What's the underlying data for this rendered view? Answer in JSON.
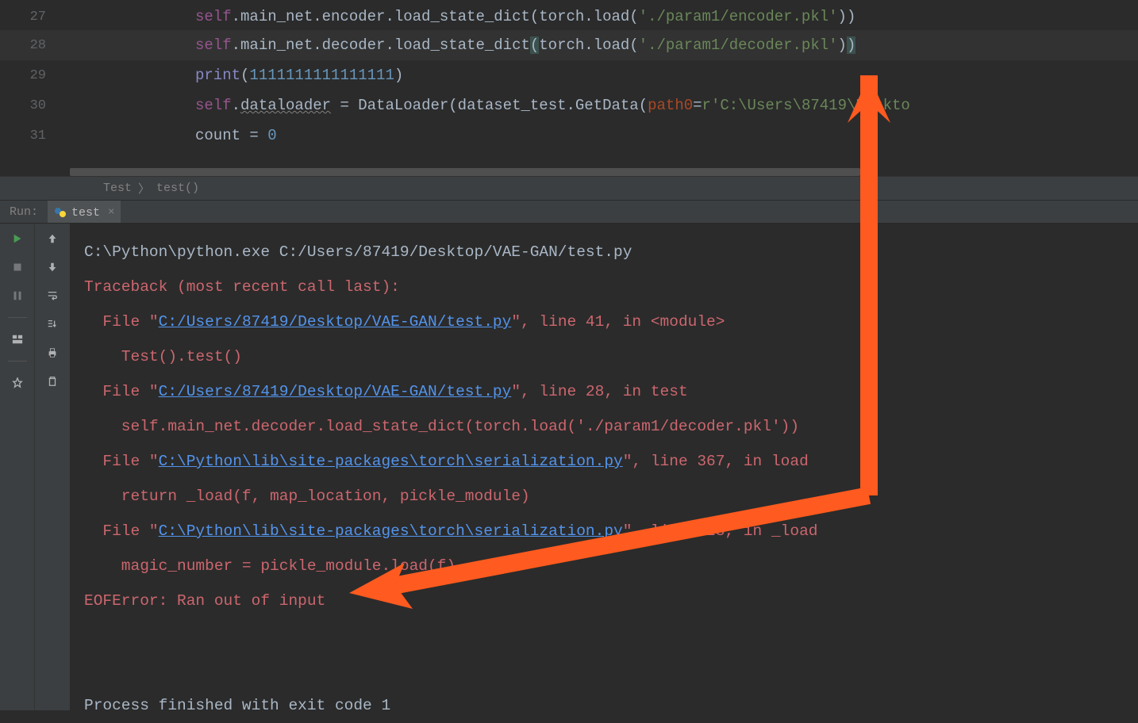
{
  "editor": {
    "lines": [
      {
        "num": "27"
      },
      {
        "num": "28"
      },
      {
        "num": "29"
      },
      {
        "num": "30"
      },
      {
        "num": "31"
      }
    ],
    "l27_self": "self",
    "l27_rest1": ".main_net.encoder.load_state_dict(torch.load(",
    "l27_str": "'./param1/encoder.pkl'",
    "l27_rest2": "))",
    "l28_self": "self",
    "l28_rest1": ".main_net.decoder.load_state_dict",
    "l28_paren1": "(",
    "l28_mid": "torch.load(",
    "l28_str": "'./param1/decoder.pkl'",
    "l28_close1": ")",
    "l28_close2": ")",
    "l29_print": "print",
    "l29_open": "(",
    "l29_num": "1111111111111111",
    "l29_close": ")",
    "l30_self": "self",
    "l30_rest1": ".",
    "l30_dataloader": "dataloader",
    "l30_rest2": " = DataLoader(dataset_test.GetData(",
    "l30_param": "path0",
    "l30_eq": "=",
    "l30_r": "r",
    "l30_str": "'C:\\Users\\87419\\Deskto",
    "l31_count": "count = ",
    "l31_zero": "0"
  },
  "breadcrumb": {
    "item1": "Test",
    "item2": "test()"
  },
  "run": {
    "label": "Run:",
    "tab_name": "test"
  },
  "console": {
    "cmd": "C:\\Python\\python.exe C:/Users/87419/Desktop/VAE-GAN/test.py",
    "tb_header": "Traceback (most recent call last):",
    "f1_pre": "  File \"",
    "f1_link": "C:/Users/87419/Desktop/VAE-GAN/test.py",
    "f1_post": "\", line 41, in <module>",
    "f1_code": "    Test().test()",
    "f2_pre": "  File \"",
    "f2_link": "C:/Users/87419/Desktop/VAE-GAN/test.py",
    "f2_post": "\", line 28, in test",
    "f2_code": "    self.main_net.decoder.load_state_dict(torch.load('./param1/decoder.pkl'))",
    "f3_pre": "  File \"",
    "f3_link": "C:\\Python\\lib\\site-packages\\torch\\serialization.py",
    "f3_post": "\", line 367, in load",
    "f3_code": "    return _load(f, map_location, pickle_module)",
    "f4_pre": "  File \"",
    "f4_link": "C:\\Python\\lib\\site-packages\\torch\\serialization.py",
    "f4_post": "\", line 528, in _load",
    "f4_code": "    magic_number = pickle_module.load(f)",
    "error": "EOFError: Ran out of input",
    "exit": "Process finished with exit code 1"
  }
}
